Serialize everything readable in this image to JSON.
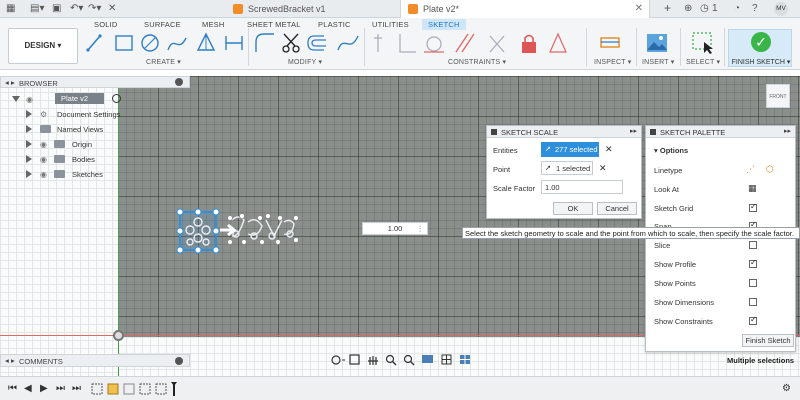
{
  "tabs": [
    {
      "label": "ScrewedBracket v1",
      "active": false,
      "cube_color": "#f28c28"
    },
    {
      "label": "Plate v2*",
      "active": true,
      "cube_color": "#f28c28"
    }
  ],
  "topbar_counters": {
    "jobs": "1",
    "user_initials": "MV"
  },
  "workspace_tabs": [
    "SOLID",
    "SURFACE",
    "MESH",
    "SHEET METAL",
    "PLASTIC",
    "UTILITIES",
    "SKETCH"
  ],
  "design_button": "DESIGN ▾",
  "toolbar_groups": {
    "create": "CREATE ▾",
    "modify": "MODIFY ▾",
    "constraints": "CONSTRAINTS ▾",
    "inspect": "INSPECT ▾",
    "insert": "INSERT ▾",
    "select": "SELECT ▾",
    "finish": "FINISH SKETCH ▾"
  },
  "browser": {
    "title": "BROWSER",
    "root": "Plate v2",
    "items": [
      "Document Settings",
      "Named Views",
      "Origin",
      "Bodies",
      "Sketches"
    ]
  },
  "sketch_scale": {
    "title": "SKETCH SCALE",
    "entities_label": "Entities",
    "entities_value": "277 selected",
    "point_label": "Point",
    "point_value": "1 selected",
    "scale_label": "Scale Factor",
    "scale_value": "1.00",
    "ok": "OK",
    "cancel": "Cancel"
  },
  "value_box": "1.00",
  "tooltip": "Select the sketch geometry to scale and the point from which to scale, then specify the scale factor.",
  "palette": {
    "title": "SKETCH PALETTE",
    "section": "Options",
    "rows": [
      {
        "label": "Linetype",
        "kind": "icons"
      },
      {
        "label": "Look At",
        "kind": "icon"
      },
      {
        "label": "Sketch Grid",
        "kind": "check",
        "checked": true
      },
      {
        "label": "Snap",
        "kind": "check",
        "checked": true
      },
      {
        "label": "Slice",
        "kind": "check",
        "checked": false
      },
      {
        "label": "Show Profile",
        "kind": "check",
        "checked": true
      },
      {
        "label": "Show Points",
        "kind": "check",
        "checked": false
      },
      {
        "label": "Show Dimensions",
        "kind": "check",
        "checked": false
      },
      {
        "label": "Show Constraints",
        "kind": "check",
        "checked": true
      }
    ],
    "finish_button": "Finish Sketch"
  },
  "comments": "COMMENTS",
  "status": "Multiple selections",
  "viewcube_label": "FRONT",
  "colors": {
    "accent": "#1f78c8",
    "selected": "#2e90dc",
    "finish_green": "#39b54a",
    "canvas": "#8a8f8c"
  }
}
